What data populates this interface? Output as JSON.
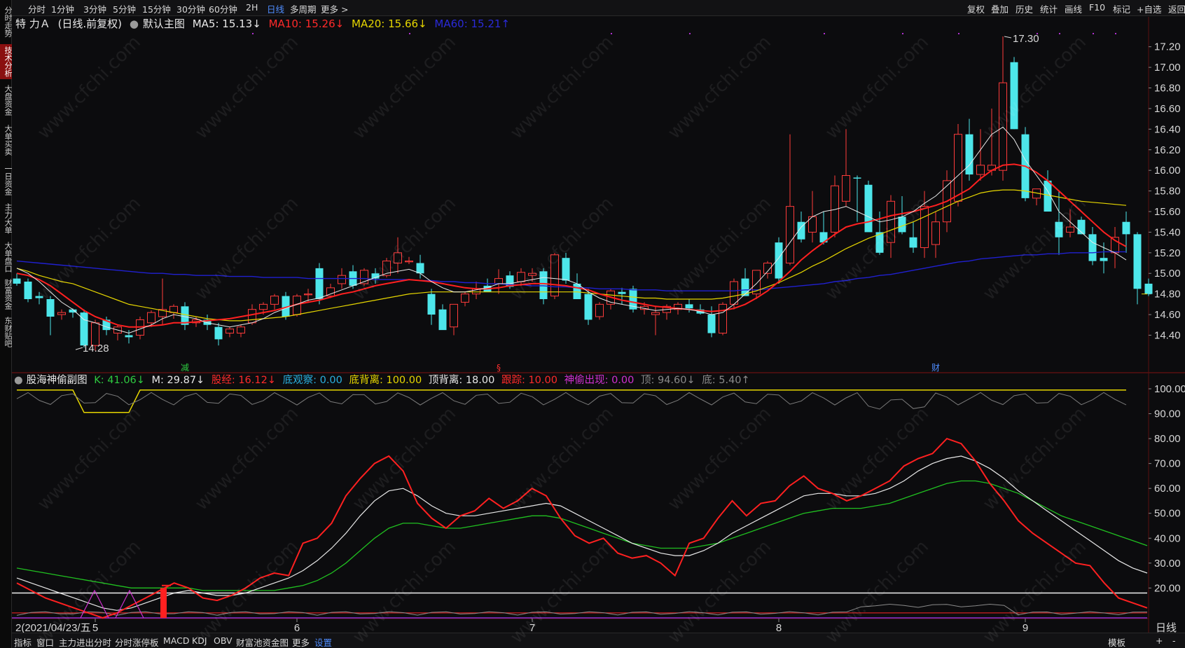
{
  "stock": {
    "name": "特 力Ａ",
    "mode": "(日线.前复权)",
    "main_chart": "默认主图",
    "ma5_label": "MA5: 15.13↓",
    "ma10_label": "MA10: 15.26↓",
    "ma20_label": "MA20: 15.66↓",
    "ma60_label": "MA60: 15.21↑"
  },
  "left_tabs": [
    "分时走势",
    "技术分析",
    "大盘资金",
    "大单买卖",
    "一日资金",
    "主力大单",
    "大单盘口",
    "财富资金",
    "东财贴吧"
  ],
  "left_active": 1,
  "period_tabs": [
    "分时",
    "1分钟",
    "3分钟",
    "5分钟",
    "15分钟",
    "30分钟",
    "60分钟",
    "2H",
    "日线",
    "多周期",
    "更多 >"
  ],
  "period_active": 8,
  "top_right_tools": [
    "复权",
    "叠加",
    "历史",
    "统计",
    "画线",
    "F10",
    "标记",
    "+自选",
    "返回"
  ],
  "sub_chart": {
    "name": "股海神偷副图",
    "k": "K: 41.06↓",
    "m": "M: 29.87↓",
    "gujing": "股经: 16.12↓",
    "diguancha": "底观察: 0.00",
    "dibeili": "底背离: 100.00",
    "dingbeili": "顶背离: 18.00",
    "genzong": "跟踪: 10.00",
    "shentou": "神偷出现: 0.00",
    "ding": "顶: 94.60↓",
    "di": "底: 5.40↑"
  },
  "price_axis": [
    "17.20",
    "17.00",
    "16.80",
    "16.60",
    "16.40",
    "16.20",
    "16.00",
    "15.80",
    "15.60",
    "15.40",
    "15.20",
    "15.00",
    "14.80",
    "14.60",
    "14.40"
  ],
  "osc_axis": [
    "100.00",
    "90.00",
    "80.00",
    "70.00",
    "60.00",
    "50.00",
    "40.00",
    "30.00",
    "20.00"
  ],
  "x_axis": [
    {
      "label": "2(2021/04/23/五",
      "i": 0
    },
    {
      "label": "5",
      "i": 7
    },
    {
      "label": "6",
      "i": 25
    },
    {
      "label": "7",
      "i": 46
    },
    {
      "label": "8",
      "i": 68
    },
    {
      "label": "9",
      "i": 90
    }
  ],
  "period_label": "日线",
  "high_mark": "17.30",
  "low_mark": "14.28",
  "event_marks": [
    {
      "text": "减",
      "i": 15,
      "color": "#2ecc40"
    },
    {
      "text": "§",
      "i": 43,
      "color": "#ff3030"
    },
    {
      "text": "财",
      "i": 82,
      "color": "#4f8dff"
    }
  ],
  "bottom_tabs": [
    "指标",
    "窗口",
    "主力进出分时",
    "分时涨停板",
    "MACD",
    "KDJ",
    "OBV",
    "财富池资金图",
    "更多",
    "设置"
  ],
  "bottom_active": 9,
  "bottom_right": [
    "模板",
    "+",
    "-"
  ],
  "watermark": "www.cfchi.com",
  "colors": {
    "up": "#ff3b3b",
    "down": "#4de6ea",
    "ma5": "#e8e8e8",
    "ma10": "#ff2020",
    "ma20": "#e6d600",
    "ma60": "#2020d0"
  },
  "chart_data": {
    "type": "candlestick",
    "ohlc": [
      [
        14.95,
        15.0,
        14.88,
        14.9
      ],
      [
        14.92,
        14.95,
        14.72,
        14.75
      ],
      [
        14.78,
        14.82,
        14.7,
        14.76
      ],
      [
        14.75,
        14.78,
        14.4,
        14.58
      ],
      [
        14.6,
        14.65,
        14.55,
        14.62
      ],
      [
        14.65,
        14.66,
        14.57,
        14.62
      ],
      [
        14.62,
        14.65,
        14.28,
        14.3
      ],
      [
        14.3,
        14.55,
        14.25,
        14.52
      ],
      [
        14.55,
        14.58,
        14.4,
        14.45
      ],
      [
        14.42,
        14.5,
        14.35,
        14.48
      ],
      [
        14.4,
        14.45,
        14.32,
        14.38
      ],
      [
        14.4,
        14.58,
        14.36,
        14.55
      ],
      [
        14.52,
        14.64,
        14.48,
        14.62
      ],
      [
        14.58,
        14.95,
        14.5,
        14.65
      ],
      [
        14.62,
        14.7,
        14.56,
        14.68
      ],
      [
        14.68,
        14.72,
        14.45,
        14.5
      ],
      [
        14.52,
        14.58,
        14.48,
        14.55
      ],
      [
        14.55,
        14.6,
        14.45,
        14.5
      ],
      [
        14.48,
        14.52,
        14.3,
        14.36
      ],
      [
        14.42,
        14.48,
        14.38,
        14.46
      ],
      [
        14.42,
        14.5,
        14.38,
        14.48
      ],
      [
        14.52,
        14.7,
        14.5,
        14.65
      ],
      [
        14.65,
        14.72,
        14.6,
        14.7
      ],
      [
        14.7,
        14.8,
        14.65,
        14.78
      ],
      [
        14.78,
        14.82,
        14.55,
        14.58
      ],
      [
        14.6,
        14.8,
        14.58,
        14.78
      ],
      [
        14.8,
        14.85,
        14.72,
        14.8
      ],
      [
        15.05,
        15.1,
        14.7,
        14.75
      ],
      [
        14.78,
        14.9,
        14.76,
        14.86
      ],
      [
        14.9,
        15.05,
        14.85,
        14.98
      ],
      [
        15.02,
        15.08,
        14.85,
        14.88
      ],
      [
        14.9,
        15.05,
        14.88,
        15.03
      ],
      [
        15.0,
        15.05,
        14.9,
        14.95
      ],
      [
        14.98,
        15.15,
        14.96,
        15.12
      ],
      [
        15.1,
        15.35,
        15.0,
        15.2
      ],
      [
        15.12,
        15.16,
        15.09,
        15.12
      ],
      [
        15.1,
        15.18,
        14.95,
        15.0
      ],
      [
        14.8,
        14.85,
        14.5,
        14.6
      ],
      [
        14.65,
        14.7,
        14.48,
        14.45
      ],
      [
        14.48,
        14.7,
        14.4,
        14.7
      ],
      [
        14.72,
        14.82,
        14.68,
        14.8
      ],
      [
        14.8,
        14.92,
        14.75,
        14.85
      ],
      [
        14.88,
        14.95,
        14.83,
        14.82
      ],
      [
        14.9,
        15.04,
        14.8,
        14.95
      ],
      [
        14.98,
        15.02,
        14.85,
        14.87
      ],
      [
        14.92,
        15.05,
        14.88,
        15.01
      ],
      [
        14.98,
        15.05,
        14.92,
        15.0
      ],
      [
        15.02,
        15.05,
        14.7,
        14.75
      ],
      [
        14.78,
        15.2,
        14.75,
        15.18
      ],
      [
        15.15,
        15.2,
        14.9,
        14.93
      ],
      [
        14.9,
        15.0,
        14.85,
        14.75
      ],
      [
        14.8,
        14.85,
        14.5,
        14.55
      ],
      [
        14.58,
        14.72,
        14.55,
        14.7
      ],
      [
        14.7,
        14.85,
        14.65,
        14.83
      ],
      [
        14.82,
        14.86,
        14.7,
        14.8
      ],
      [
        14.85,
        14.88,
        14.62,
        14.65
      ],
      [
        14.65,
        14.72,
        14.6,
        14.68
      ],
      [
        14.6,
        14.68,
        14.4,
        14.62
      ],
      [
        14.62,
        14.7,
        14.55,
        14.68
      ],
      [
        14.65,
        14.72,
        14.6,
        14.7
      ],
      [
        14.7,
        14.75,
        14.62,
        14.66
      ],
      [
        14.65,
        14.7,
        14.6,
        14.61
      ],
      [
        14.6,
        14.68,
        14.38,
        14.42
      ],
      [
        14.42,
        14.72,
        14.4,
        14.7
      ],
      [
        14.7,
        14.95,
        14.65,
        14.92
      ],
      [
        14.95,
        15.05,
        14.88,
        14.78
      ],
      [
        14.8,
        15.03,
        14.75,
        15.03
      ],
      [
        15.0,
        15.12,
        14.95,
        15.1
      ],
      [
        15.3,
        15.35,
        14.9,
        14.95
      ],
      [
        15.1,
        16.35,
        15.08,
        15.65
      ],
      [
        15.5,
        15.6,
        15.3,
        15.33
      ],
      [
        15.4,
        15.8,
        15.3,
        15.55
      ],
      [
        15.4,
        15.6,
        15.28,
        15.3
      ],
      [
        15.4,
        15.95,
        15.35,
        15.85
      ],
      [
        15.7,
        16.4,
        15.65,
        15.95
      ],
      [
        15.93,
        15.95,
        15.5,
        15.92
      ],
      [
        15.86,
        15.9,
        15.7,
        15.4
      ],
      [
        15.4,
        15.6,
        15.18,
        15.2
      ],
      [
        15.3,
        15.76,
        15.15,
        15.7
      ],
      [
        15.55,
        15.75,
        15.38,
        15.4
      ],
      [
        15.35,
        15.5,
        15.2,
        15.25
      ],
      [
        15.25,
        15.8,
        15.15,
        15.65
      ],
      [
        15.28,
        15.6,
        15.15,
        15.5
      ],
      [
        15.5,
        16.0,
        15.4,
        15.9
      ],
      [
        15.7,
        16.45,
        15.65,
        16.35
      ],
      [
        16.35,
        16.5,
        15.9,
        15.96
      ],
      [
        15.96,
        16.4,
        15.9,
        16.05
      ],
      [
        16.0,
        16.6,
        15.95,
        16.05
      ],
      [
        16.0,
        17.3,
        15.9,
        16.85
      ],
      [
        17.05,
        17.1,
        16.4,
        16.4
      ],
      [
        16.35,
        16.42,
        15.7,
        15.73
      ],
      [
        15.73,
        15.82,
        15.66,
        15.82
      ],
      [
        15.9,
        16.0,
        15.65,
        15.6
      ],
      [
        15.5,
        15.8,
        15.18,
        15.35
      ],
      [
        15.4,
        15.62,
        15.35,
        15.45
      ],
      [
        15.52,
        15.55,
        15.38,
        15.38
      ],
      [
        15.38,
        15.45,
        15.08,
        15.12
      ],
      [
        15.15,
        15.3,
        15.0,
        15.12
      ],
      [
        15.2,
        15.45,
        15.05,
        15.35
      ],
      [
        15.5,
        15.6,
        15.2,
        15.38
      ],
      [
        15.38,
        15.4,
        14.7,
        14.85
      ],
      [
        14.9,
        14.95,
        14.78,
        14.8
      ]
    ],
    "ma5": [
      15.05,
      15.0,
      14.92,
      14.82,
      14.72,
      14.65,
      14.55,
      14.52,
      14.48,
      14.45,
      14.42,
      14.46,
      14.5,
      14.56,
      14.6,
      14.58,
      14.56,
      14.52,
      14.5,
      14.48,
      14.5,
      14.52,
      14.56,
      14.62,
      14.66,
      14.7,
      14.74,
      14.76,
      14.8,
      14.84,
      14.88,
      14.92,
      14.96,
      15.0,
      15.02,
      15.04,
      15.0,
      14.92,
      14.86,
      14.82,
      14.82,
      14.84,
      14.86,
      14.9,
      14.9,
      14.92,
      14.94,
      14.96,
      14.95,
      14.94,
      14.9,
      14.82,
      14.76,
      14.72,
      14.7,
      14.68,
      14.66,
      14.64,
      14.65,
      14.66,
      14.65,
      14.63,
      14.6,
      14.62,
      14.7,
      14.8,
      14.9,
      15.02,
      15.15,
      15.3,
      15.45,
      15.55,
      15.6,
      15.62,
      15.65,
      15.6,
      15.55,
      15.5,
      15.52,
      15.55,
      15.6,
      15.68,
      15.75,
      15.85,
      15.95,
      16.05,
      16.2,
      16.35,
      16.42,
      16.3,
      16.1,
      15.95,
      15.8,
      15.6,
      15.5,
      15.4,
      15.3,
      15.25,
      15.2,
      15.13
    ],
    "ma10": [
      15.0,
      14.98,
      14.94,
      14.88,
      14.8,
      14.72,
      14.64,
      14.58,
      14.54,
      14.5,
      14.48,
      14.48,
      14.49,
      14.5,
      14.52,
      14.52,
      14.53,
      14.54,
      14.55,
      14.56,
      14.58,
      14.6,
      14.62,
      14.64,
      14.67,
      14.7,
      14.72,
      14.74,
      14.77,
      14.8,
      14.82,
      14.85,
      14.88,
      14.9,
      14.92,
      14.94,
      14.93,
      14.92,
      14.9,
      14.88,
      14.86,
      14.85,
      14.85,
      14.86,
      14.88,
      14.89,
      14.9,
      14.9,
      14.89,
      14.88,
      14.86,
      14.84,
      14.8,
      14.77,
      14.74,
      14.72,
      14.7,
      14.68,
      14.67,
      14.66,
      14.65,
      14.64,
      14.63,
      14.64,
      14.66,
      14.7,
      14.76,
      14.83,
      14.92,
      15.02,
      15.13,
      15.22,
      15.3,
      15.38,
      15.45,
      15.48,
      15.5,
      15.53,
      15.56,
      15.58,
      15.6,
      15.63,
      15.66,
      15.7,
      15.76,
      15.82,
      15.92,
      16.0,
      16.05,
      16.06,
      16.04,
      15.98,
      15.9,
      15.8,
      15.7,
      15.6,
      15.5,
      15.4,
      15.32,
      15.26
    ],
    "ma20": [
      15.05,
      15.02,
      14.98,
      14.95,
      14.92,
      14.9,
      14.86,
      14.82,
      14.78,
      14.74,
      14.7,
      14.68,
      14.66,
      14.64,
      14.62,
      14.6,
      14.58,
      14.56,
      14.55,
      14.54,
      14.54,
      14.55,
      14.56,
      14.57,
      14.58,
      14.6,
      14.62,
      14.64,
      14.66,
      14.68,
      14.7,
      14.72,
      14.74,
      14.76,
      14.78,
      14.8,
      14.81,
      14.82,
      14.82,
      14.82,
      14.82,
      14.82,
      14.82,
      14.82,
      14.82,
      14.82,
      14.82,
      14.82,
      14.82,
      14.82,
      14.82,
      14.81,
      14.8,
      14.79,
      14.78,
      14.77,
      14.76,
      14.76,
      14.75,
      14.75,
      14.75,
      14.75,
      14.75,
      14.76,
      14.78,
      14.8,
      14.83,
      14.87,
      14.91,
      14.96,
      15.01,
      15.07,
      15.12,
      15.18,
      15.24,
      15.29,
      15.34,
      15.38,
      15.42,
      15.46,
      15.5,
      15.55,
      15.6,
      15.65,
      15.7,
      15.74,
      15.78,
      15.8,
      15.81,
      15.81,
      15.8,
      15.78,
      15.76,
      15.74,
      15.72,
      15.7,
      15.69,
      15.68,
      15.67,
      15.66
    ],
    "ma60": [
      15.12,
      15.11,
      15.1,
      15.09,
      15.08,
      15.07,
      15.06,
      15.05,
      15.04,
      15.03,
      15.02,
      15.01,
      15.0,
      15.0,
      14.99,
      14.99,
      14.98,
      14.98,
      14.98,
      14.97,
      14.97,
      14.97,
      14.96,
      14.96,
      14.96,
      14.96,
      14.95,
      14.95,
      14.95,
      14.95,
      14.95,
      14.95,
      14.94,
      14.94,
      14.94,
      14.94,
      14.93,
      14.93,
      14.92,
      14.92,
      14.91,
      14.91,
      14.9,
      14.9,
      14.89,
      14.89,
      14.88,
      14.88,
      14.87,
      14.87,
      14.86,
      14.86,
      14.85,
      14.85,
      14.85,
      14.84,
      14.84,
      14.84,
      14.83,
      14.83,
      14.83,
      14.83,
      14.83,
      14.83,
      14.83,
      14.84,
      14.84,
      14.85,
      14.86,
      14.87,
      14.88,
      14.89,
      14.9,
      14.92,
      14.93,
      14.95,
      14.96,
      14.98,
      14.99,
      15.01,
      15.03,
      15.05,
      15.07,
      15.09,
      15.11,
      15.12,
      15.14,
      15.15,
      15.16,
      15.17,
      15.18,
      15.18,
      15.19,
      15.19,
      15.2,
      15.2,
      15.2,
      15.21,
      15.21,
      15.21
    ],
    "osc_k": [
      22,
      19,
      16,
      14,
      12,
      10,
      8,
      10,
      13,
      16,
      19,
      22,
      20,
      16,
      15,
      17,
      20,
      24,
      26,
      25,
      38,
      40,
      46,
      57,
      64,
      70,
      73,
      67,
      54,
      48,
      44,
      49,
      51,
      56,
      52,
      55,
      60,
      57,
      48,
      41,
      38,
      40,
      34,
      32,
      33,
      30,
      25,
      38,
      40,
      48,
      55,
      49,
      54,
      55,
      61,
      65,
      60,
      58,
      55,
      57,
      60,
      63,
      69,
      72,
      74,
      80,
      78,
      71,
      62,
      55,
      47,
      42,
      38,
      34,
      30,
      29,
      22,
      16,
      14,
      12
    ],
    "osc_m": [
      24,
      22,
      20,
      18,
      16,
      14,
      12,
      11,
      12,
      14,
      16,
      18,
      19,
      18,
      17,
      17,
      18,
      20,
      22,
      24,
      27,
      31,
      36,
      42,
      49,
      55,
      59,
      60,
      57,
      53,
      50,
      49,
      49,
      50,
      51,
      52,
      53,
      54,
      53,
      50,
      47,
      44,
      41,
      38,
      36,
      34,
      33,
      33,
      35,
      38,
      42,
      45,
      48,
      51,
      54,
      57,
      58,
      58,
      57,
      57,
      58,
      60,
      63,
      67,
      70,
      72,
      73,
      71,
      68,
      64,
      59,
      55,
      51,
      47,
      43,
      39,
      35,
      31,
      28,
      26
    ],
    "osc_g": [
      28,
      27,
      26,
      25,
      24,
      23,
      22,
      21,
      20,
      20,
      20,
      20,
      20,
      19,
      19,
      19,
      19,
      19,
      19,
      20,
      21,
      23,
      26,
      30,
      35,
      40,
      44,
      46,
      46,
      45,
      44,
      44,
      45,
      46,
      47,
      48,
      49,
      49,
      48,
      46,
      44,
      42,
      40,
      38,
      37,
      36,
      36,
      36,
      37,
      38,
      40,
      42,
      44,
      46,
      48,
      50,
      51,
      52,
      52,
      52,
      53,
      54,
      56,
      58,
      60,
      62,
      63,
      63,
      62,
      60,
      58,
      55,
      52,
      49,
      47,
      45,
      43,
      41,
      39,
      37
    ]
  }
}
